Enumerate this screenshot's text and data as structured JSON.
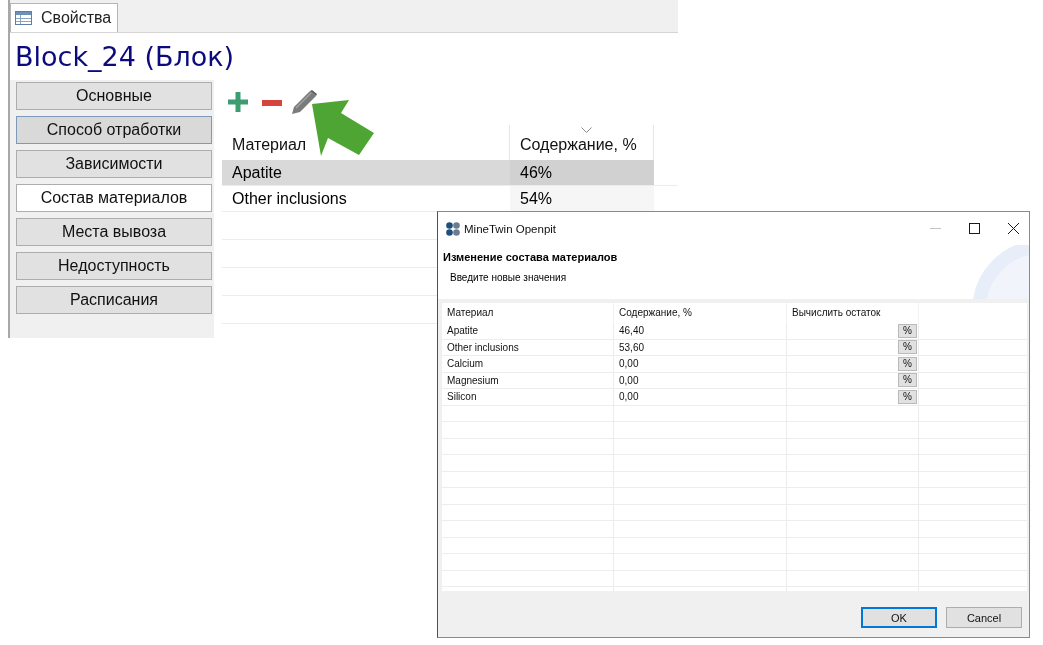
{
  "panel": {
    "tab": {
      "label": "Свойства",
      "selected": true
    },
    "title": "Block_24 (Блок)",
    "nav": [
      {
        "label": "Основные",
        "selected": false,
        "hovered": false
      },
      {
        "label": "Способ отработки",
        "selected": false,
        "hovered": true
      },
      {
        "label": "Зависимости",
        "selected": false,
        "hovered": false
      },
      {
        "label": "Состав материалов",
        "selected": true,
        "hovered": false
      },
      {
        "label": "Места вывоза",
        "selected": false,
        "hovered": false
      },
      {
        "label": "Недоступность",
        "selected": false,
        "hovered": false
      },
      {
        "label": "Расписания",
        "selected": false,
        "hovered": false
      }
    ],
    "table": {
      "columns": [
        {
          "label": "Материал",
          "sorted": false
        },
        {
          "label": "Содержание, %",
          "sorted": true
        }
      ],
      "rows": [
        {
          "cells": [
            "Apatite",
            "46%"
          ],
          "selected": true
        },
        {
          "cells": [
            "Other inclusions",
            "54%"
          ],
          "selected": false
        }
      ]
    }
  },
  "dialog": {
    "title": "MineTwin Openpit",
    "window_controls": [
      {
        "kind": "minimize",
        "disabled": true
      },
      {
        "kind": "maximize",
        "disabled": false
      },
      {
        "kind": "close",
        "disabled": false
      }
    ],
    "heading": "Изменение состава материалов",
    "subheading": "Введите новые значения",
    "table": {
      "columns": [
        "Материал",
        "Содержание, %",
        "Вычислить остаток"
      ],
      "rows": [
        {
          "cells": [
            "Apatite",
            "46,40"
          ],
          "button": "%"
        },
        {
          "cells": [
            "Other inclusions",
            "53,60"
          ],
          "button": "%"
        },
        {
          "cells": [
            "Calcium",
            "0,00"
          ],
          "button": "%"
        },
        {
          "cells": [
            "Magnesium",
            "0,00"
          ],
          "button": "%"
        },
        {
          "cells": [
            "Silicon",
            "0,00"
          ],
          "button": "%"
        }
      ]
    },
    "buttons": [
      {
        "label": "OK",
        "default": true
      },
      {
        "label": "Cancel",
        "default": false
      }
    ]
  }
}
